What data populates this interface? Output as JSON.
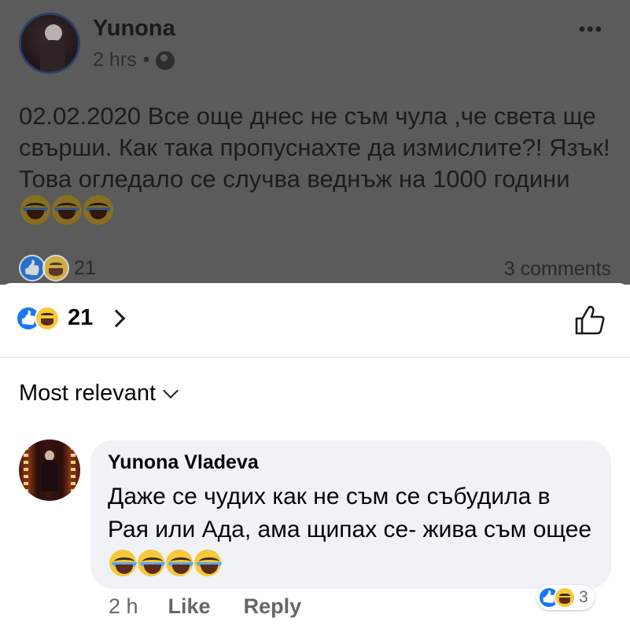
{
  "post": {
    "author": "Yunona",
    "time": "2 hrs",
    "separator": "•",
    "more_icon": "•••",
    "text": "02.02.2020 Все още днес не съм чула ,че света ще свърши. Как така пропуснахте да измислите?! Язък!Това огледало се случва веднъж на 1000 години",
    "reaction_count": "21",
    "comments_label": "3 comments"
  },
  "sheet": {
    "reaction_count": "21",
    "sort_label": "Most relevant"
  },
  "comment": {
    "author": "Yunona Vladeva",
    "text": "Даже се чудих как не съм се събудила в Рая или Ада, ама щипах се- жива съм ощее",
    "reaction_count": "3",
    "time": "2 h",
    "like_label": "Like",
    "reply_label": "Reply"
  },
  "icons": {
    "like_reaction": "like-reaction-icon",
    "haha_reaction": "haha-reaction-icon",
    "emoji": "laughing-crying-emoji",
    "globe": "globe-icon",
    "thumb": "thumbs-up-outline-icon"
  },
  "colors": {
    "facebook_blue": "#1877f2",
    "haha_yellow": "#f7c83a",
    "bubble_bg": "#f0f2f5",
    "secondary_text": "#65676b"
  }
}
